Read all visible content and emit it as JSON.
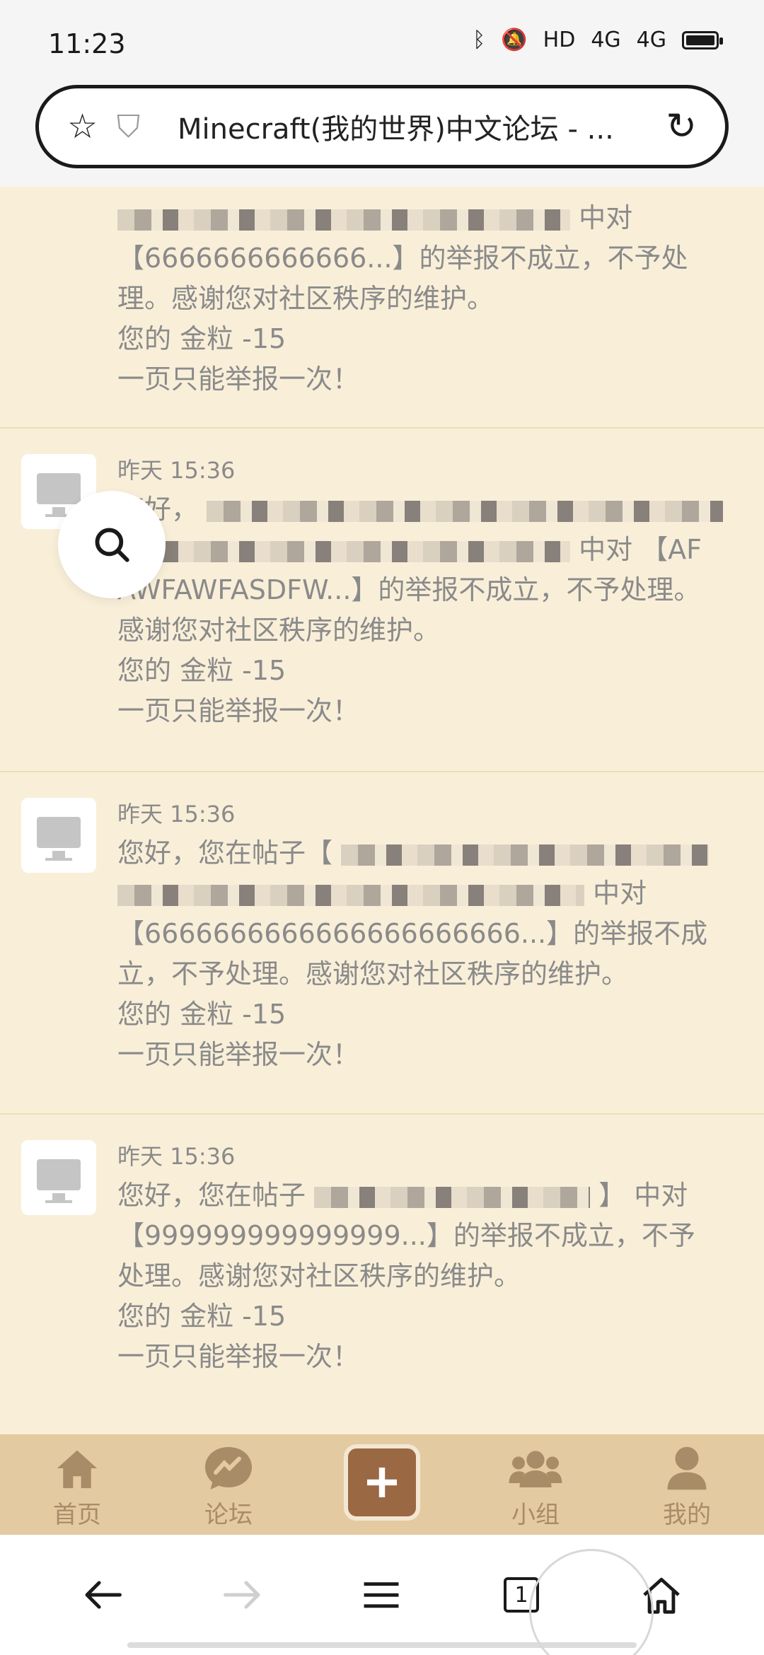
{
  "status_bar": {
    "time": "11:23",
    "icons": [
      "bluetooth-icon",
      "mute-icon",
      "hd-icon",
      "4g-signal-icon",
      "4g-signal-icon",
      "battery-icon"
    ],
    "hd_label": "HD",
    "net_label_1": "4G",
    "net_label_2": "4G"
  },
  "address_bar": {
    "url_text": "Minecraft(我的世界)中文论坛 - ..."
  },
  "notices": [
    {
      "time": "",
      "lines": [
        "中对",
        "【6666666666666...】的举报不成立，不予处",
        "理。感谢您对社区秩序的维护。",
        "您的 金粒 -15",
        "一页只能举报一次！"
      ]
    },
    {
      "time": "昨天 15:36",
      "lines": [
        "您好，",
        "中对 【AF",
        "AWFAWFASDFW...】的举报不成立，不予处理。",
        "感谢您对社区秩序的维护。",
        "您的 金粒 -15",
        "一页只能举报一次！"
      ]
    },
    {
      "time": "昨天 15:36",
      "lines": [
        "您好，您在帖子【",
        "中对",
        "【6666666666666666666666...】的举报不成",
        "立，不予处理。感谢您对社区秩序的维护。",
        "您的 金粒 -15",
        "一页只能举报一次！"
      ]
    },
    {
      "time": "昨天 15:36",
      "lines": [
        "您好，您在帖子",
        "】 中对",
        "【999999999999999...】的举报不成立，不予",
        "处理。感谢您对社区秩序的维护。",
        "您的 金粒 -15",
        "一页只能举报一次！"
      ]
    }
  ],
  "app_nav": {
    "home": "首页",
    "forum": "论坛",
    "groups": "小组",
    "mine": "我的"
  },
  "browser_nav": {
    "tab_count": "1"
  }
}
